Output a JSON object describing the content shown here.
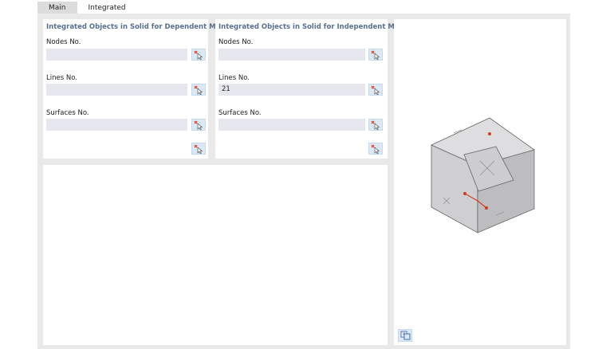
{
  "tabs": [
    {
      "label": "Main"
    },
    {
      "label": "Integrated"
    }
  ],
  "dependent": {
    "title": "Integrated Objects in Solid for Dependent Mesh",
    "nodes_label": "Nodes No.",
    "nodes_value": "",
    "lines_label": "Lines No.",
    "lines_value": "",
    "surfaces_label": "Surfaces No.",
    "surfaces_value": ""
  },
  "independent": {
    "title": "Integrated Objects in Solid for Independent Mesh",
    "nodes_label": "Nodes No.",
    "nodes_value": "",
    "lines_label": "Lines No.",
    "lines_value": "21",
    "surfaces_label": "Surfaces No.",
    "surfaces_value": ""
  },
  "icons": {
    "pick": "pick-cursor-icon",
    "preview": "view-options-icon"
  },
  "colors": {
    "title_blue": "#5a6f8f",
    "field_bg": "#e6e6ef",
    "button_bg": "#dbe8f6",
    "highlight_red": "#d9371f"
  }
}
